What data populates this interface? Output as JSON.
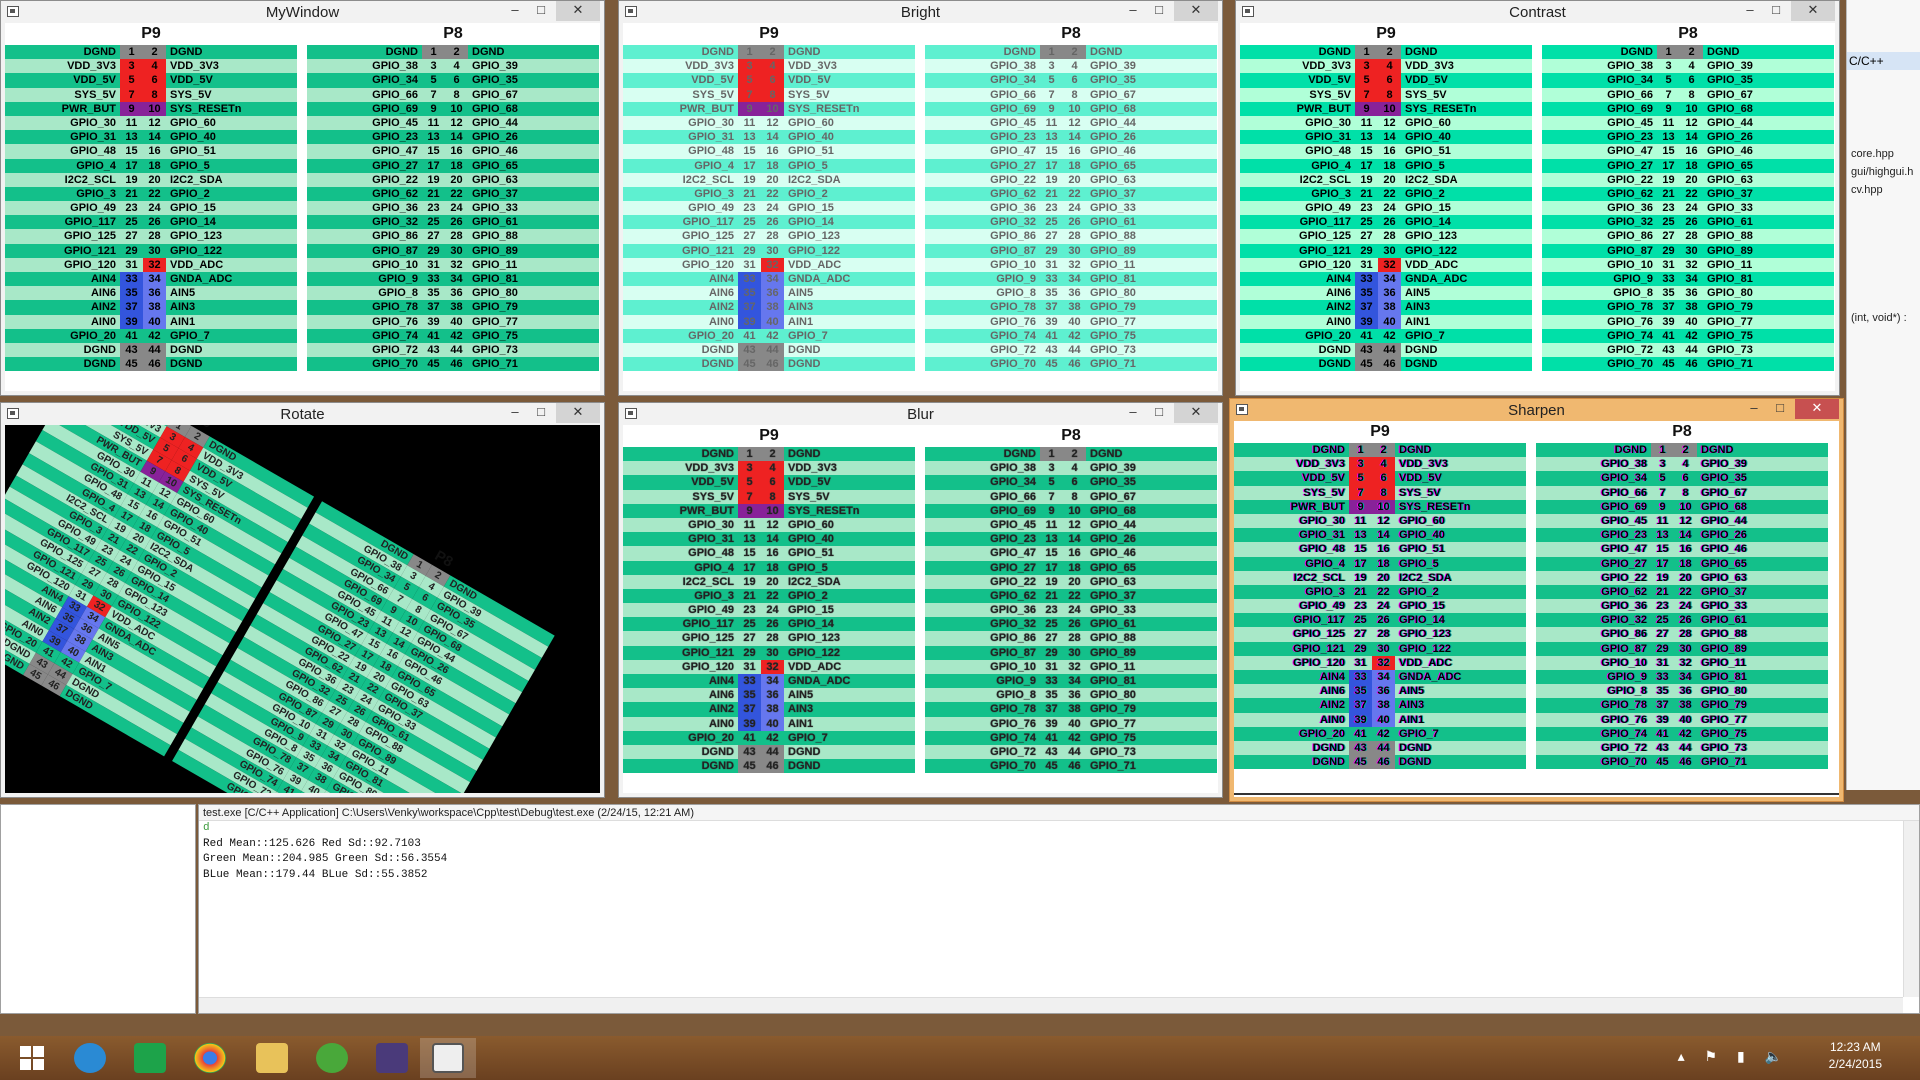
{
  "windows": [
    {
      "title": "MyWindow",
      "fx": "normal"
    },
    {
      "title": "Bright",
      "fx": "bright"
    },
    {
      "title": "Contrast",
      "fx": "contrast"
    },
    {
      "title": "Rotate",
      "fx": "rotate"
    },
    {
      "title": "Blur",
      "fx": "blur"
    },
    {
      "title": "Sharpen",
      "fx": "sharpen"
    }
  ],
  "board": {
    "p9": {
      "title": "P9",
      "rows": [
        [
          "DGND",
          "1",
          "2",
          "DGND"
        ],
        [
          "VDD_3V3",
          "3",
          "4",
          "VDD_3V3"
        ],
        [
          "VDD_5V",
          "5",
          "6",
          "VDD_5V"
        ],
        [
          "SYS_5V",
          "7",
          "8",
          "SYS_5V"
        ],
        [
          "PWR_BUT",
          "9",
          "10",
          "SYS_RESETn"
        ],
        [
          "GPIO_30",
          "11",
          "12",
          "GPIO_60"
        ],
        [
          "GPIO_31",
          "13",
          "14",
          "GPIO_40"
        ],
        [
          "GPIO_48",
          "15",
          "16",
          "GPIO_51"
        ],
        [
          "GPIO_4",
          "17",
          "18",
          "GPIO_5"
        ],
        [
          "I2C2_SCL",
          "19",
          "20",
          "I2C2_SDA"
        ],
        [
          "GPIO_3",
          "21",
          "22",
          "GPIO_2"
        ],
        [
          "GPIO_49",
          "23",
          "24",
          "GPIO_15"
        ],
        [
          "GPIO_117",
          "25",
          "26",
          "GPIO_14"
        ],
        [
          "GPIO_125",
          "27",
          "28",
          "GPIO_123"
        ],
        [
          "GPIO_121",
          "29",
          "30",
          "GPIO_122"
        ],
        [
          "GPIO_120",
          "31",
          "32",
          "VDD_ADC"
        ],
        [
          "AIN4",
          "33",
          "34",
          "GNDA_ADC"
        ],
        [
          "AIN6",
          "35",
          "36",
          "AIN5"
        ],
        [
          "AIN2",
          "37",
          "38",
          "AIN3"
        ],
        [
          "AIN0",
          "39",
          "40",
          "AIN1"
        ],
        [
          "GPIO_20",
          "41",
          "42",
          "GPIO_7"
        ],
        [
          "DGND",
          "43",
          "44",
          "DGND"
        ],
        [
          "DGND",
          "45",
          "46",
          "DGND"
        ]
      ]
    },
    "p8": {
      "title": "P8",
      "rows": [
        [
          "DGND",
          "1",
          "2",
          "DGND"
        ],
        [
          "GPIO_38",
          "3",
          "4",
          "GPIO_39"
        ],
        [
          "GPIO_34",
          "5",
          "6",
          "GPIO_35"
        ],
        [
          "GPIO_66",
          "7",
          "8",
          "GPIO_67"
        ],
        [
          "GPIO_69",
          "9",
          "10",
          "GPIO_68"
        ],
        [
          "GPIO_45",
          "11",
          "12",
          "GPIO_44"
        ],
        [
          "GPIO_23",
          "13",
          "14",
          "GPIO_26"
        ],
        [
          "GPIO_47",
          "15",
          "16",
          "GPIO_46"
        ],
        [
          "GPIO_27",
          "17",
          "18",
          "GPIO_65"
        ],
        [
          "GPIO_22",
          "19",
          "20",
          "GPIO_63"
        ],
        [
          "GPIO_62",
          "21",
          "22",
          "GPIO_37"
        ],
        [
          "GPIO_36",
          "23",
          "24",
          "GPIO_33"
        ],
        [
          "GPIO_32",
          "25",
          "26",
          "GPIO_61"
        ],
        [
          "GPIO_86",
          "27",
          "28",
          "GPIO_88"
        ],
        [
          "GPIO_87",
          "29",
          "30",
          "GPIO_89"
        ],
        [
          "GPIO_10",
          "31",
          "32",
          "GPIO_11"
        ],
        [
          "GPIO_9",
          "33",
          "34",
          "GPIO_81"
        ],
        [
          "GPIO_8",
          "35",
          "36",
          "GPIO_80"
        ],
        [
          "GPIO_78",
          "37",
          "38",
          "GPIO_79"
        ],
        [
          "GPIO_76",
          "39",
          "40",
          "GPIO_77"
        ],
        [
          "GPIO_74",
          "41",
          "42",
          "GPIO_75"
        ],
        [
          "GPIO_72",
          "43",
          "44",
          "GPIO_73"
        ],
        [
          "GPIO_70",
          "45",
          "46",
          "GPIO_71"
        ]
      ]
    }
  },
  "pin_colors": {
    "gray": "#888888",
    "red": "#ee2222",
    "purple": "#882299",
    "blue": "#3355dd",
    "lightblue": "#6677ee",
    "teal": "#13c08a",
    "pale": "#a8e8c8"
  },
  "console": {
    "header": "test.exe [C/C++ Application] C:\\Users\\Venky\\workspace\\Cpp\\test\\Debug\\test.exe (2/24/15, 12:21 AM)",
    "lines": [
      "d",
      "Red Mean::125.626 Red Sd::92.7103",
      "Green Mean::204.985 Green Sd::56.3554",
      "BLue Mean::179.44 BLue Sd::55.3852"
    ]
  },
  "eclipse": {
    "tab": "C/C++",
    "files": [
      "core.hpp",
      "gui/highgui.h",
      "cv.hpp"
    ],
    "signature": "(int, void*) :"
  },
  "taskbar": {
    "time": "12:23 AM",
    "date": "2/24/2015"
  }
}
